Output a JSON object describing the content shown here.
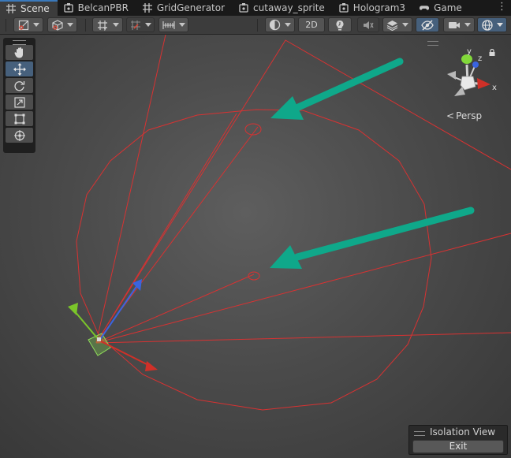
{
  "tabs": [
    {
      "label": "Scene",
      "icon": "grid-icon",
      "active": true
    },
    {
      "label": "BelcanPBR",
      "icon": "shader-graph-icon",
      "active": false
    },
    {
      "label": "GridGenerator",
      "icon": "grid-icon",
      "active": false
    },
    {
      "label": "cutaway_sprite",
      "icon": "shader-graph-icon",
      "active": false
    },
    {
      "label": "Hologram3",
      "icon": "shader-graph-icon",
      "active": false
    },
    {
      "label": "Game",
      "icon": "gamepad-icon",
      "active": false
    }
  ],
  "toolbar": {
    "mode_2d_label": "2D"
  },
  "gizmo": {
    "axis_x": "x",
    "axis_y": "y",
    "axis_z": "z",
    "projection_label": "Persp"
  },
  "isolation": {
    "title": "Isolation View",
    "exit_label": "Exit"
  },
  "colors": {
    "background": "#282828",
    "active_tab_accent": "#3a79bb",
    "frustum_lines": "#d83232",
    "annotation_arrow": "#0fa88a",
    "axis_x": "#d03028",
    "axis_y": "#7bc62a",
    "axis_z": "#3a64e0"
  }
}
